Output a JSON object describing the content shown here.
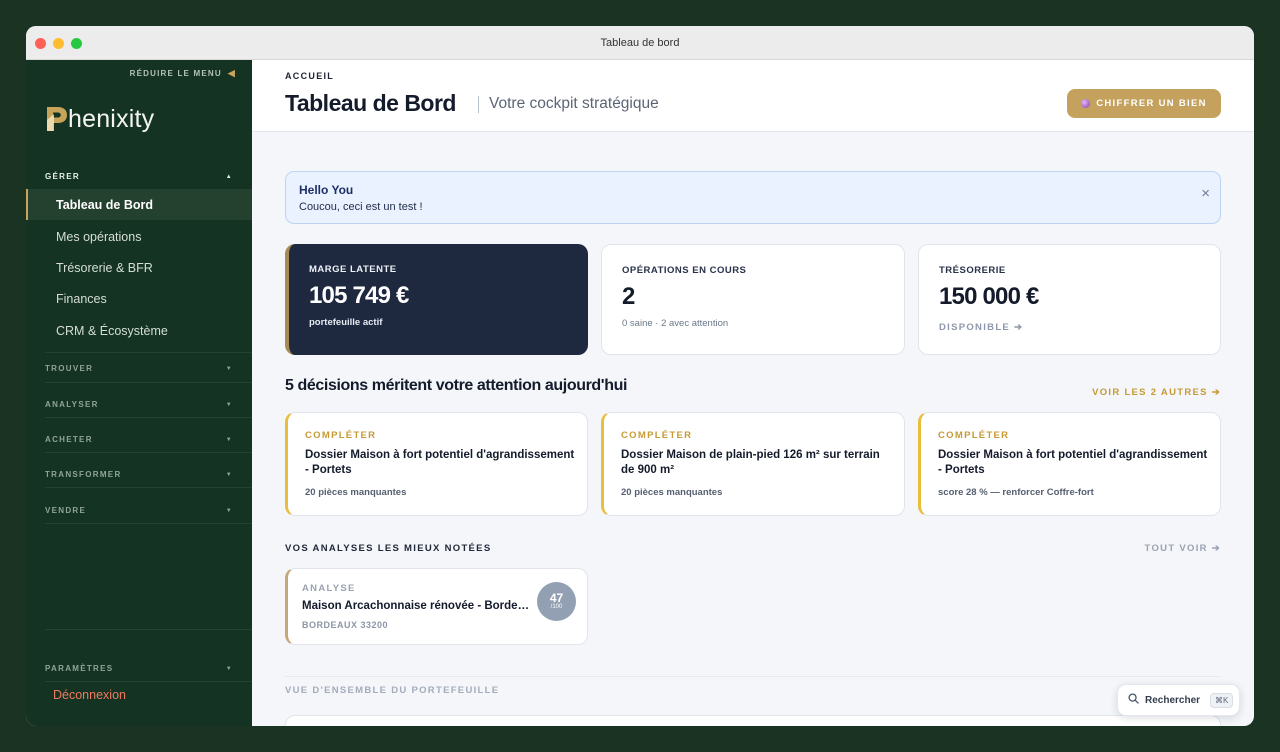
{
  "window": {
    "title": "Tableau de bord"
  },
  "sidebar": {
    "collapse_label": "RÉDUIRE LE MENU",
    "logo_text": "henixity",
    "sections": [
      {
        "label": "GÉRER",
        "state": "open"
      },
      {
        "label": "TROUVER",
        "state": "closed"
      },
      {
        "label": "ANALYSER",
        "state": "closed"
      },
      {
        "label": "ACHETER",
        "state": "closed"
      },
      {
        "label": "TRANSFORMER",
        "state": "closed"
      },
      {
        "label": "VENDRE",
        "state": "closed"
      }
    ],
    "items": [
      {
        "label": "Tableau de Bord",
        "active": true
      },
      {
        "label": "Mes opérations"
      },
      {
        "label": "Trésorerie & BFR"
      },
      {
        "label": "Finances"
      },
      {
        "label": "CRM & Écosystème"
      }
    ],
    "settings_label": "PARAMÈTRES",
    "logout_label": "Déconnexion",
    "colors": {
      "background": "#153322",
      "accent": "#c7a45a",
      "logout": "#ef7a5f"
    }
  },
  "header": {
    "breadcrumb": "ACCUEIL",
    "title": "Tableau de Bord",
    "subtitle": "Votre cockpit stratégique",
    "cta_label": "CHIFFRER UN BIEN",
    "cta_color": "#c4a15c"
  },
  "alert": {
    "title": "Hello You",
    "text": "Coucou, ceci est un test !",
    "close": "×"
  },
  "kpis": [
    {
      "label": "MARGE LATENTE",
      "value": "105 749 €",
      "sub": "portefeuille actif"
    },
    {
      "label": "OPÉRATIONS EN COURS",
      "value": "2",
      "sub": "0 saine · 2 avec attention"
    },
    {
      "label": "TRÉSORERIE",
      "value": "150 000 €",
      "link": "DISPONIBLE ➔"
    }
  ],
  "decisions": {
    "title": "5 décisions méritent votre attention aujourd'hui",
    "more_label": "VOIR LES 2 AUTRES ➔",
    "items": [
      {
        "tag": "COMPLÉTER",
        "title": "Dossier Maison à fort potentiel d'agrandissement - Portets",
        "sub": "20 pièces manquantes"
      },
      {
        "tag": "COMPLÉTER",
        "title": "Dossier Maison de plain-pied 126 m² sur terrain de 900 m²",
        "sub": "20 pièces manquantes"
      },
      {
        "tag": "COMPLÉTER",
        "title": "Dossier Maison à fort potentiel d'agrandissement - Portets",
        "sub": "score 28 % — renforcer Coffre-fort"
      }
    ]
  },
  "analyses": {
    "title": "VOS ANALYSES LES MIEUX NOTÉES",
    "more_label": "TOUT VOIR ➔",
    "items": [
      {
        "tag": "ANALYSE",
        "title": "Maison Arcachonnaise rénovée - Bordeaux",
        "location": "BORDEAUX 33200",
        "score": "47",
        "score_max": "/100"
      }
    ]
  },
  "portfolio": {
    "title": "VUE D'ENSEMBLE DU PORTEFEUILLE"
  },
  "search": {
    "label": "Rechercher",
    "shortcut": "⌘K"
  }
}
